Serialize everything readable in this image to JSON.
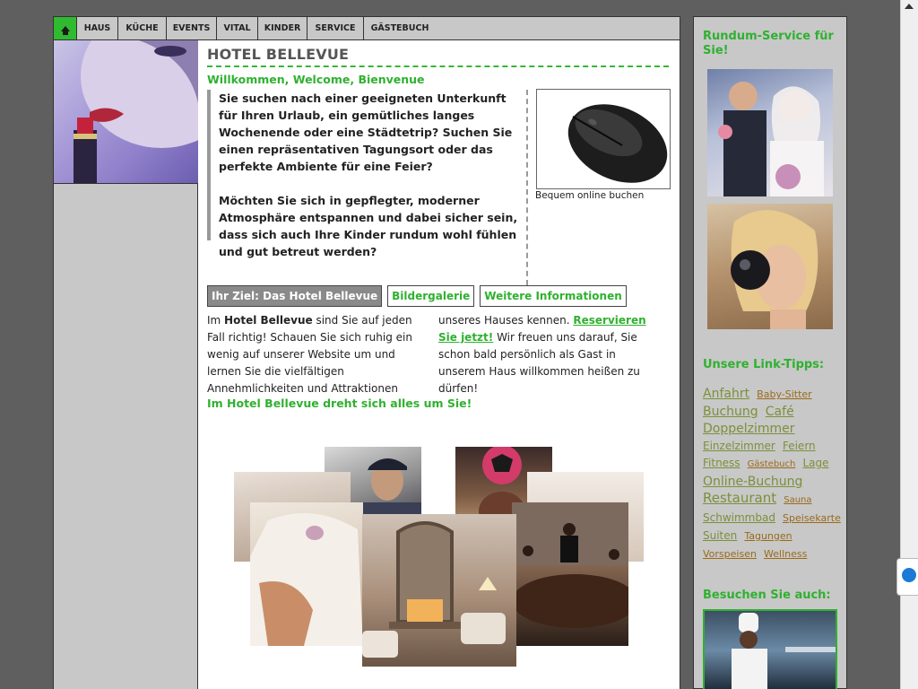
{
  "nav": {
    "items": [
      "HAUS",
      "KÜCHE",
      "EVENTS",
      "VITAL",
      "KINDER",
      "SERVICE",
      "GÄSTEBUCH"
    ]
  },
  "main": {
    "title": "HOTEL BELLEVUE",
    "welcome": "Willkommen, Welcome, Bienvenue",
    "intro_p1": "Sie suchen nach einer geeigneten Unterkunft für Ihren Urlaub, ein gemütliches langes Wochenende oder eine Städtetrip? Suchen Sie einen repräsentativen Tagungsort oder das perfekte Ambiente für eine Feier?",
    "intro_p2": "Möchten Sie sich in gepflegter, moderner Atmosphäre entspannen und dabei sicher sein, dass sich auch Ihre Kinder rundum wohl fühlen und gut betreut werden?",
    "mouse_caption": "Bequem online buchen",
    "tabs": [
      "Ihr Ziel: Das Hotel Bellevue",
      "Bildergalerie",
      "Weitere Informationen"
    ],
    "col_left_a": "Im ",
    "col_left_b": "Hotel Bellevue",
    "col_left_c": " sind Sie auf jeden Fall richtig! Schauen Sie sich ruhig ein wenig auf unserer Website um und lernen Sie die vielfältigen Annehmlichkeiten und Attraktionen",
    "col_right_a": "unseres Hauses kennen. ",
    "col_right_link": "Reservieren Sie jetzt!",
    "col_right_b": " Wir freuen uns darauf, Sie schon bald persönlich als Gast in unserem Haus willkommen heißen zu dürfen!",
    "slogan": "Im Hotel Bellevue dreht sich alles um Sie!"
  },
  "right": {
    "service_heading": "Rundum-Service für Sie!",
    "links_heading": "Unsere Link-Tipps:",
    "tags": [
      {
        "label": "Anfahrt",
        "size": "s3"
      },
      {
        "label": "Baby-Sitter",
        "size": "s1"
      },
      {
        "label": "Buchung",
        "size": "s3"
      },
      {
        "label": "Café",
        "size": "s3"
      },
      {
        "label": "Doppelzimmer",
        "size": "s3"
      },
      {
        "label": "Einzelzimmer",
        "size": "s2"
      },
      {
        "label": "Feiern",
        "size": "s2"
      },
      {
        "label": "Fitness",
        "size": "s2"
      },
      {
        "label": "Gästebuch",
        "size": "s5"
      },
      {
        "label": "Lage",
        "size": "s2"
      },
      {
        "label": "Online-Buchung",
        "size": "s3"
      },
      {
        "label": "Restaurant",
        "size": "s4"
      },
      {
        "label": "Sauna",
        "size": "s5"
      },
      {
        "label": "Schwimmbad",
        "size": "s2"
      },
      {
        "label": "Speisekarte",
        "size": "s1"
      },
      {
        "label": "Suiten",
        "size": "s2"
      },
      {
        "label": "Tagungen",
        "size": "s1"
      },
      {
        "label": "Vorspeisen",
        "size": "s1"
      },
      {
        "label": "Wellness",
        "size": "s1"
      }
    ],
    "visit_heading": "Besuchen Sie auch:"
  },
  "icons": {
    "home": "home-icon",
    "teamviewer": "teamviewer-icon"
  },
  "colors": {
    "accent_green": "#2fb12f",
    "nav_bg": "#c8c8c8",
    "page_bg": "#5f5f5f"
  }
}
